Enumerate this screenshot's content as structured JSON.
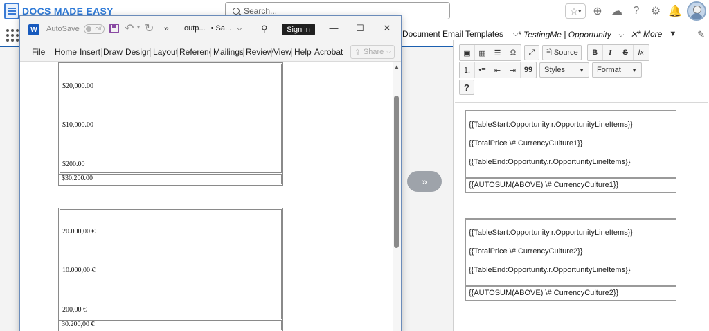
{
  "sf_header": {
    "logo_text": "DOCS MADE EASY",
    "search_placeholder": "Search...",
    "icons": [
      "star-icon",
      "chevron-down-icon",
      "plus-icon",
      "cloud-icon",
      "help-icon",
      "gear-icon",
      "bell-icon",
      "avatar"
    ]
  },
  "sf_nav": {
    "tabs": [
      {
        "label": "Document Email Templates"
      },
      {
        "label": "* TestingMe | Opportunity"
      },
      {
        "label": "* More"
      }
    ]
  },
  "word": {
    "autosave_label": "AutoSave",
    "autosave_state": "Off",
    "doc_name": "outp...",
    "doc_status": "• Sa...",
    "signin_label": "Sign in",
    "overflow_label": "»",
    "ribbon_tabs": [
      "File",
      "Home",
      "Insert",
      "Draw",
      "Design",
      "Layout",
      "Reference",
      "Mailings",
      "Review",
      "View",
      "Help",
      "Acrobat"
    ],
    "share_label": "Share",
    "table1": {
      "values": [
        "$20,000.00",
        "$10,000.00",
        "$200.00"
      ],
      "sum": "$30,200.00"
    },
    "table2": {
      "values": [
        "20.000,00 €",
        "10.000,00 €",
        "200,00 €"
      ],
      "sum": "30.200,00 €"
    }
  },
  "convert_button": {
    "label": "»"
  },
  "editor": {
    "toolbar": {
      "source_label": "Source",
      "bold": "B",
      "italic": "I",
      "strike": "S",
      "clear": "Ix",
      "styles_label": "Styles",
      "format_label": "Format",
      "help": "?",
      "omega": "Ω",
      "quote": "99"
    },
    "block1": {
      "lines": [
        "{{TableStart:Opportunity.r.OpportunityLineItems}}",
        "{{TotalPrice \\# CurrencyCulture1}}",
        "{{TableEnd:Opportunity.r.OpportunityLineItems}}"
      ],
      "sum": "{{AUTOSUM(ABOVE) \\# CurrencyCulture1}}"
    },
    "block2": {
      "lines": [
        "{{TableStart:Opportunity.r.OpportunityLineItems}}",
        "{{TotalPrice \\# CurrencyCulture2}}",
        "{{TableEnd:Opportunity.r.OpportunityLineItems}}"
      ],
      "sum": "{{AUTOSUM(ABOVE) \\# CurrencyCulture2}}"
    }
  },
  "colors": {
    "brand_blue": "#2f7bd8",
    "nav_accent": "#1b5fb0",
    "word_blue": "#185abd",
    "signin_bg": "#1f1f1f"
  }
}
